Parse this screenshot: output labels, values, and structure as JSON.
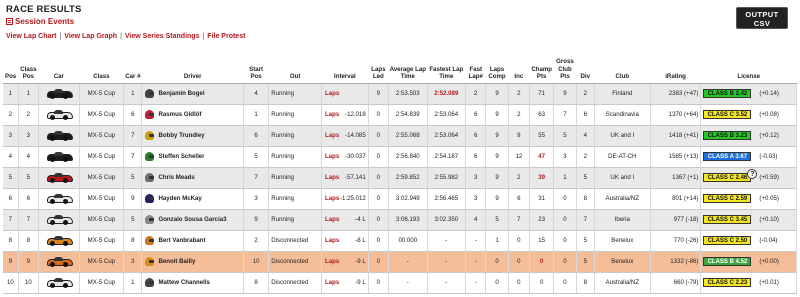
{
  "header": {
    "title": "RACE RESULTS",
    "subtitle": "Session Events",
    "output_csv": [
      "OUTPUT",
      "CSV"
    ]
  },
  "links": [
    "View Lap Chart",
    "View Lap Graph",
    "View Series Standings",
    "File Protest"
  ],
  "columns": [
    "Pos",
    "Class Pos",
    "Car",
    "Class",
    "Car #",
    "Driver",
    "Start Pos",
    "Out",
    "Interval",
    "Laps Led",
    "Average Lap Time",
    "Fastest Lap Time",
    "Fast Lap#",
    "Laps Comp",
    "Inc",
    "Champ Pts",
    "Gross Club Pts",
    "Div",
    "Club",
    "iRating",
    "License"
  ],
  "rows": [
    {
      "pos": "1",
      "class_pos": "1",
      "car_color": "#1b1b1b",
      "class": "MX-5 Cup",
      "car_num": "1",
      "helmet": "#444",
      "driver": "Benjamin Bogel",
      "start": "4",
      "out": "Running",
      "out_link": "Laps",
      "interval": "",
      "laps_led": "9",
      "avg": "2:53.503",
      "fast": "2:52.089",
      "fast_red": true,
      "fast_lap": "2",
      "laps": "9",
      "inc": "2",
      "champ": "71",
      "champ_red": false,
      "gross": "9",
      "div": "2",
      "club": "Finland",
      "irating": "2383 (+47)",
      "lic": "CLASS B 2.42",
      "lic_color": "#26c826",
      "lic_text": "#111",
      "change": "(+0.14)",
      "highlight": false,
      "tooltip": false
    },
    {
      "pos": "2",
      "class_pos": "2",
      "car_color": "#e6e6e6",
      "class": "MX-5 Cup",
      "car_num": "6",
      "helmet": "#b23",
      "driver": "Rasmus Gidlöf",
      "start": "1",
      "out": "Running",
      "out_link": "Laps",
      "interval": "-12.018",
      "laps_led": "0",
      "avg": "2:54.839",
      "fast": "2:53.064",
      "fast_red": false,
      "fast_lap": "6",
      "laps": "9",
      "inc": "2",
      "champ": "63",
      "champ_red": false,
      "gross": "7",
      "div": "6",
      "club": "Scandinavia",
      "irating": "1370 (+64)",
      "lic": "CLASS C 3.52",
      "lic_color": "#f5e625",
      "lic_text": "#111",
      "change": "(+0.08)",
      "highlight": false,
      "tooltip": false
    },
    {
      "pos": "3",
      "class_pos": "3",
      "car_color": "#1b1b1b",
      "class": "MX-5 Cup",
      "car_num": "7",
      "helmet": "#c8a000",
      "driver": "Bobby Trundley",
      "start": "6",
      "out": "Running",
      "out_link": "Laps",
      "interval": "-14.085",
      "laps_led": "0",
      "avg": "2:55.068",
      "fast": "2:53.064",
      "fast_red": false,
      "fast_lap": "6",
      "laps": "9",
      "inc": "9",
      "champ": "55",
      "champ_red": false,
      "gross": "5",
      "div": "4",
      "club": "UK and I",
      "irating": "1418 (+41)",
      "lic": "CLASS B 3.23",
      "lic_color": "#26c826",
      "lic_text": "#111",
      "change": "(+0.12)",
      "highlight": false,
      "tooltip": false
    },
    {
      "pos": "4",
      "class_pos": "4",
      "car_color": "#1b1b1b",
      "class": "MX-5 Cup",
      "car_num": "7",
      "helmet": "#2a7a2a",
      "driver": "Steffen Scheller",
      "start": "5",
      "out": "Running",
      "out_link": "Laps",
      "interval": "-30.037",
      "laps_led": "0",
      "avg": "2:56.840",
      "fast": "2:54.187",
      "fast_red": false,
      "fast_lap": "6",
      "laps": "9",
      "inc": "12",
      "champ": "47",
      "champ_red": true,
      "gross": "3",
      "div": "2",
      "club": "DE-AT-CH",
      "irating": "1585 (+13)",
      "lic": "CLASS A 3.67",
      "lic_color": "#1e6fd9",
      "lic_text": "#fff",
      "change": "(-0.03)",
      "highlight": false,
      "tooltip": false
    },
    {
      "pos": "5",
      "class_pos": "5",
      "car_color": "#c0171c",
      "class": "MX-5 Cup",
      "car_num": "5",
      "helmet": "#6d6d6d",
      "driver": "Chris Meads",
      "start": "7",
      "out": "Running",
      "out_link": "Laps",
      "interval": "-57.141",
      "laps_led": "0",
      "avg": "2:59.852",
      "fast": "2:55.982",
      "fast_red": false,
      "fast_lap": "3",
      "laps": "9",
      "inc": "2",
      "champ": "39",
      "champ_red": true,
      "gross": "1",
      "div": "5",
      "club": "UK and I",
      "irating": "1367 (+1)",
      "lic": "CLASS C 2.46",
      "lic_color": "#f5e625",
      "lic_text": "#111",
      "change": "(+0.59)",
      "highlight": false,
      "tooltip": true
    },
    {
      "pos": "6",
      "class_pos": "6",
      "car_color": "#e6e6e6",
      "class": "MX-5 Cup",
      "car_num": "9",
      "helmet": "#226",
      "driver": "Hayden McKay",
      "start": "3",
      "out": "Running",
      "out_link": "Laps",
      "interval": "-1:25.012",
      "laps_led": "0",
      "avg": "3:02.949",
      "fast": "2:56.465",
      "fast_red": false,
      "fast_lap": "3",
      "laps": "9",
      "inc": "6",
      "champ": "31",
      "champ_red": false,
      "gross": "0",
      "div": "8",
      "club": "Australia/NZ",
      "irating": "801 (+14)",
      "lic": "CLASS C 2.59",
      "lic_color": "#f5e625",
      "lic_text": "#111",
      "change": "(+0.05)",
      "highlight": false,
      "tooltip": false
    },
    {
      "pos": "7",
      "class_pos": "7",
      "car_color": "#e6e6e6",
      "class": "MX-5 Cup",
      "car_num": "5",
      "helmet": "#888",
      "driver": "Gonzalo Sousa Garcia3",
      "start": "9",
      "out": "Running",
      "out_link": "Laps",
      "interval": "-4 L",
      "laps_led": "0",
      "avg": "3:06.193",
      "fast": "3:02.350",
      "fast_red": false,
      "fast_lap": "4",
      "laps": "5",
      "inc": "7",
      "champ": "23",
      "champ_red": false,
      "gross": "0",
      "div": "7",
      "club": "Iberia",
      "irating": "977 (-18)",
      "lic": "CLASS C 3.45",
      "lic_color": "#f5e625",
      "lic_text": "#111",
      "change": "(+0.10)",
      "highlight": false,
      "tooltip": false
    },
    {
      "pos": "8",
      "class_pos": "8",
      "car_color": "#d9861a",
      "class": "MX-5 Cup",
      "car_num": "8",
      "helmet": "#c87a1a",
      "driver": "Bert Vanbrabant",
      "start": "2",
      "out": "Disconnected",
      "out_link": "Laps",
      "interval": "-8 L",
      "laps_led": "0",
      "avg": "00.000",
      "fast": "-",
      "fast_red": false,
      "fast_lap": "-",
      "laps": "1",
      "inc": "0",
      "champ": "15",
      "champ_red": false,
      "gross": "0",
      "div": "5",
      "club": "Benelux",
      "irating": "770 (-26)",
      "lic": "CLASS C 2.50",
      "lic_color": "#f5e625",
      "lic_text": "#111",
      "change": "(-0.04)",
      "highlight": false,
      "tooltip": false
    },
    {
      "pos": "9",
      "class_pos": "9",
      "car_color": "#d96a1a",
      "class": "MX-5 Cup",
      "car_num": "3",
      "helmet": "#d98b1a",
      "driver": "Benoit Bailly",
      "start": "10",
      "out": "Disconnected",
      "out_link": "Laps",
      "interval": "-9 L",
      "laps_led": "0",
      "avg": "-",
      "fast": "-",
      "fast_red": false,
      "fast_lap": "-",
      "laps": "0",
      "inc": "0",
      "champ": "0",
      "champ_red": true,
      "gross": "0",
      "div": "5",
      "club": "Benelux",
      "irating": "1332 (-86)",
      "lic": "CLASS B 4.52",
      "lic_color": "#3aa83a",
      "lic_text": "#fff",
      "change": "(+0.00)",
      "highlight": true,
      "tooltip": false
    },
    {
      "pos": "10",
      "class_pos": "10",
      "car_color": "#e6e6e6",
      "class": "MX-5 Cup",
      "car_num": "1",
      "helmet": "#444",
      "driver": "Mattew Channells",
      "start": "8",
      "out": "Disconnected",
      "out_link": "Laps",
      "interval": "-9 L",
      "laps_led": "0",
      "avg": "-",
      "fast": "-",
      "fast_red": false,
      "fast_lap": "-",
      "laps": "0",
      "inc": "0",
      "champ": "0",
      "champ_red": false,
      "gross": "0",
      "div": "8",
      "club": "Australia/NZ",
      "irating": "660 (-79)",
      "lic": "CLASS C 2.23",
      "lic_color": "#f5e625",
      "lic_text": "#111",
      "change": "(+0.01)",
      "highlight": false,
      "tooltip": false
    }
  ]
}
